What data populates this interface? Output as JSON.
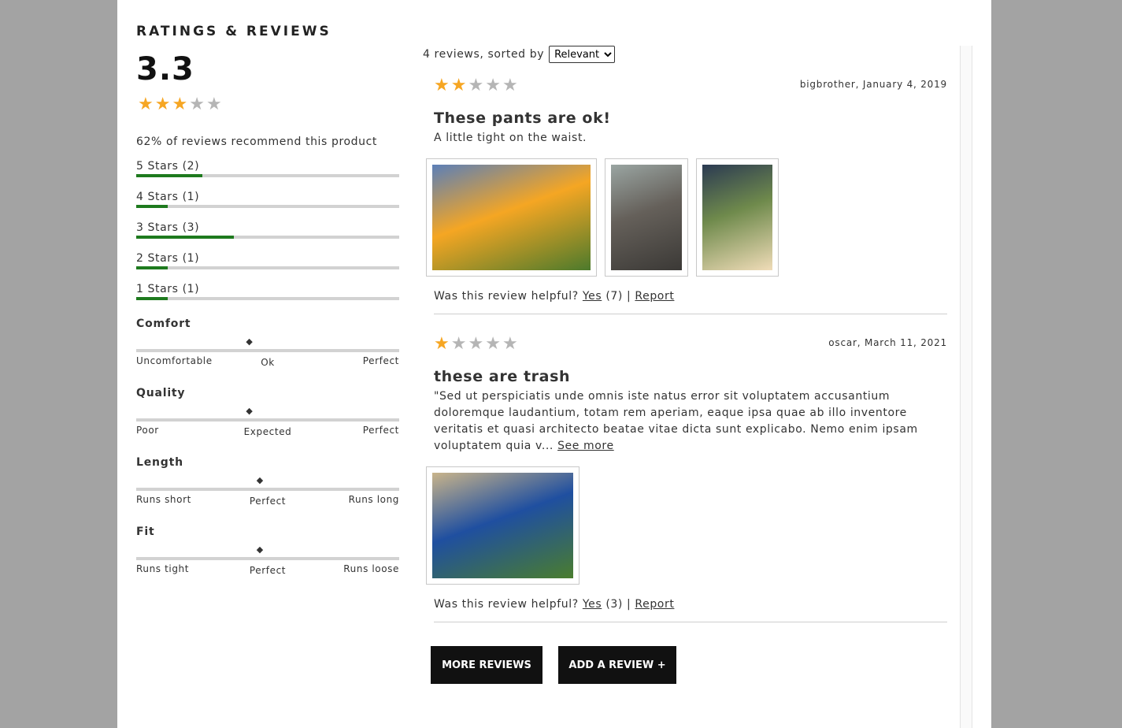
{
  "header": {
    "title": "RATINGS & REVIEWS"
  },
  "summary": {
    "average": "3.3",
    "average_stars": 3.3,
    "recommend_text": "62% of reviews recommend this product",
    "breakdown": [
      {
        "label": "5 Stars (2)",
        "fraction": 0.25
      },
      {
        "label": "4 Stars (1)",
        "fraction": 0.12
      },
      {
        "label": "3 Stars (3)",
        "fraction": 0.37
      },
      {
        "label": "2 Stars (1)",
        "fraction": 0.12
      },
      {
        "label": "1 Stars (1)",
        "fraction": 0.12
      }
    ]
  },
  "characteristics": [
    {
      "name": "Comfort",
      "value_fraction": 0.43,
      "low": "Uncomfortable",
      "mid": "Ok",
      "high": "Perfect"
    },
    {
      "name": "Quality",
      "value_fraction": 0.43,
      "low": "Poor",
      "mid": "Expected",
      "high": "Perfect"
    },
    {
      "name": "Length",
      "value_fraction": 0.47,
      "low": "Runs short",
      "mid": "Perfect",
      "high": "Runs long"
    },
    {
      "name": "Fit",
      "value_fraction": 0.47,
      "low": "Runs tight",
      "mid": "Perfect",
      "high": "Runs loose"
    }
  ],
  "list": {
    "count_text": "4 reviews, sorted by",
    "sort_selected": "Relevant",
    "sort_options": [
      "Relevant"
    ]
  },
  "reviews": [
    {
      "rating": 2,
      "meta": "bigbrother, January 4, 2019",
      "summary": "These pants are ok!",
      "body": "A little tight on the waist.",
      "see_more": "",
      "photos": [
        {
          "name": "photo-jeans-lying-grass",
          "colors": [
            "#4c7a2c",
            "#f5a623",
            "#5b7fb8"
          ]
        },
        {
          "name": "photo-woman-standing-dirt",
          "colors": [
            "#3b3936",
            "#65605a",
            "#9aa5a2"
          ]
        },
        {
          "name": "photo-man-field-trees",
          "colors": [
            "#f0dcb8",
            "#6f8a4c",
            "#2b3a52"
          ]
        }
      ],
      "helpful_prefix": "Was this review helpful?",
      "yes": "Yes",
      "count": "(7) |",
      "report": "Report"
    },
    {
      "rating": 1,
      "meta": "oscar, March 11, 2021",
      "summary": "these are trash",
      "body": "\"Sed ut perspiciatis unde omnis iste natus error sit voluptatem accusantium doloremque laudantium, totam rem aperiam, eaque ipsa quae ab illo inventore veritatis et quasi architecto beatae vitae dicta sunt explicabo. Nemo enim ipsam voluptatem quia v...",
      "see_more": "See more",
      "photos": [
        {
          "name": "photo-trash-pile",
          "colors": [
            "#4a7d2e",
            "#1f4fa0",
            "#c9b48a"
          ]
        }
      ],
      "helpful_prefix": "Was this review helpful?",
      "yes": "Yes",
      "count": "(3) |",
      "report": "Report"
    }
  ],
  "buttons": {
    "more": "MORE REVIEWS",
    "add": "ADD A REVIEW +"
  }
}
